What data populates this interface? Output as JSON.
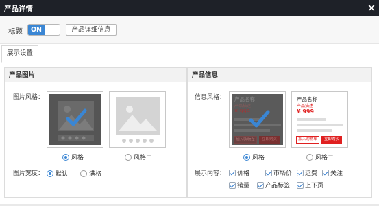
{
  "window": {
    "title": "产品详情",
    "close_symbol": "✕"
  },
  "toolbar": {
    "title_label": "标题",
    "toggle_on": "ON",
    "detail_button": "产品详细信息"
  },
  "tabs": [
    {
      "label": "展示设置",
      "active": true
    }
  ],
  "image_panel": {
    "header": "产品图片",
    "style_label": "图片风格：",
    "styles": [
      {
        "label": "风格一",
        "selected": true
      },
      {
        "label": "风格二",
        "selected": false
      }
    ],
    "width_label": "图片宽度：",
    "width_options": [
      {
        "label": "默认",
        "selected": true
      },
      {
        "label": "满格",
        "selected": false
      }
    ]
  },
  "info_panel": {
    "header": "产品信息",
    "style_label": "信息风格：",
    "preview": {
      "name": "产品名称",
      "desc": "产品描述",
      "price": "¥ 999",
      "cart_button": "加入购物车",
      "buy_button": "立即购买"
    },
    "styles": [
      {
        "label": "风格一",
        "selected": true
      },
      {
        "label": "风格二",
        "selected": false
      }
    ],
    "content_label": "展示内容：",
    "content_options": [
      {
        "label": "价格",
        "checked": true
      },
      {
        "label": "市场价",
        "checked": true
      },
      {
        "label": "运费",
        "checked": true
      },
      {
        "label": "关注",
        "checked": true
      },
      {
        "label": "销量",
        "checked": true
      },
      {
        "label": "产品标签",
        "checked": true
      },
      {
        "label": "上下页",
        "checked": true
      }
    ]
  },
  "colors": {
    "titlebar": "#1e2128",
    "accent": "#3a86d4",
    "price_red": "#e02020",
    "selected_overlay": "#555555"
  }
}
